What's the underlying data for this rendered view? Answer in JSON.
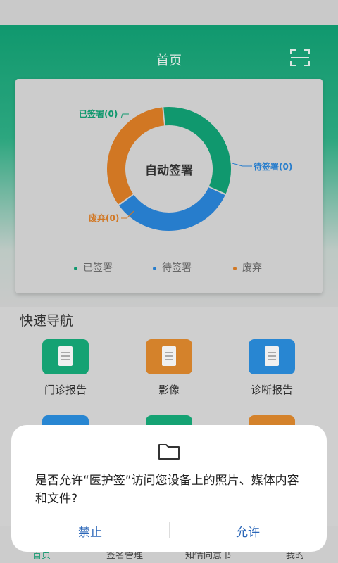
{
  "header": {
    "title": "首页"
  },
  "chart_data": {
    "type": "pie",
    "center_label": "自动签署",
    "slices": [
      {
        "name": "已签署",
        "label": "已签署(0)",
        "value": 0,
        "color": "#12a275"
      },
      {
        "name": "待签署",
        "label": "待签署(0)",
        "value": 0,
        "color": "#2a85d9"
      },
      {
        "name": "废弃",
        "label": "废弃(0)",
        "value": 0,
        "color": "#df7f26"
      }
    ],
    "legend": [
      "已签署",
      "待签署",
      "废弃"
    ],
    "legend_position": "bottom"
  },
  "quick_nav": {
    "title": "快速导航",
    "items": [
      {
        "label": "门诊报告",
        "color": "#17ad7b"
      },
      {
        "label": "影像",
        "color": "#e28b2e"
      },
      {
        "label": "诊断报告",
        "color": "#2b8fe0"
      }
    ]
  },
  "bottom_nav": {
    "items": [
      "首页",
      "签名管理",
      "知情同意书",
      "我的"
    ],
    "active_color": "#12a275"
  },
  "dialog": {
    "message": "是否允许“医护签”访问您设备上的照片、媒体内容和文件?",
    "deny_label": "禁止",
    "allow_label": "允许"
  }
}
